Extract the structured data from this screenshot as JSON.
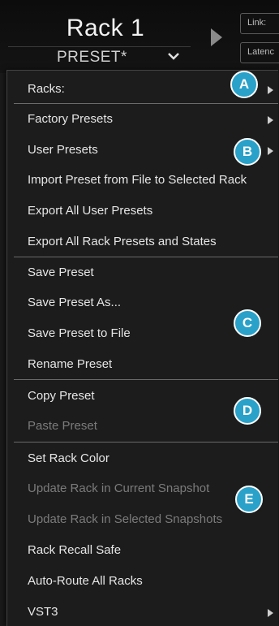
{
  "header": {
    "rack_title": "Rack 1",
    "preset_name": "PRESET*",
    "link_label": "Link:",
    "latency_label": "Latenc"
  },
  "menu": {
    "items": [
      {
        "label": "Racks:",
        "submenu": true,
        "enabled": true
      },
      {
        "label": "Factory Presets",
        "submenu": true,
        "enabled": true
      },
      {
        "label": "User Presets",
        "submenu": true,
        "enabled": true
      },
      {
        "label": "Import Preset from File to Selected Rack",
        "submenu": false,
        "enabled": true
      },
      {
        "label": "Export All User Presets",
        "submenu": false,
        "enabled": true
      },
      {
        "label": "Export All Rack Presets and States",
        "submenu": false,
        "enabled": true
      },
      {
        "label": "Save Preset",
        "submenu": false,
        "enabled": true
      },
      {
        "label": "Save Preset As...",
        "submenu": false,
        "enabled": true
      },
      {
        "label": "Save Preset to File",
        "submenu": false,
        "enabled": true
      },
      {
        "label": "Rename Preset",
        "submenu": false,
        "enabled": true
      },
      {
        "label": "Copy Preset",
        "submenu": false,
        "enabled": true
      },
      {
        "label": "Paste Preset",
        "submenu": false,
        "enabled": false
      },
      {
        "label": "Set Rack Color",
        "submenu": false,
        "enabled": true
      },
      {
        "label": "Update Rack in Current Snapshot",
        "submenu": false,
        "enabled": false
      },
      {
        "label": "Update Rack in Selected Snapshots",
        "submenu": false,
        "enabled": false
      },
      {
        "label": "Rack Recall Safe",
        "submenu": false,
        "enabled": true
      },
      {
        "label": "Auto-Route All Racks",
        "submenu": false,
        "enabled": true
      },
      {
        "label": "VST3",
        "submenu": true,
        "enabled": true
      }
    ]
  },
  "callouts": [
    "A",
    "B",
    "C",
    "D",
    "E"
  ],
  "colors": {
    "callout_fill": "#2aa1c9",
    "menu_background": "#1c1c1c",
    "text_enabled": "#e6e6e6",
    "text_disabled": "#7b7b7b"
  }
}
